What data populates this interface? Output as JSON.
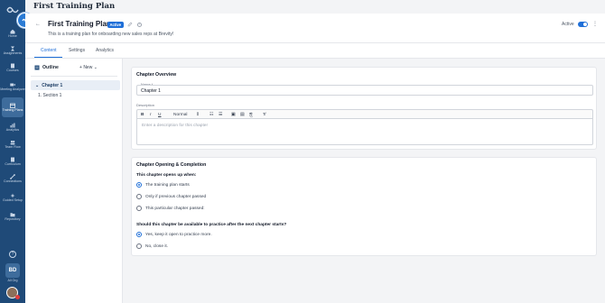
{
  "app": {
    "title": "First Training Plan"
  },
  "sidebar": {
    "items": [
      {
        "label": "Home",
        "icon": "home-icon"
      },
      {
        "label": "Assignments",
        "icon": "hourglass-icon"
      },
      {
        "label": "Courses",
        "icon": "book-icon"
      },
      {
        "label": "Meeting Analyzer",
        "icon": "video-icon"
      },
      {
        "label": "Training Plans",
        "icon": "calendar-icon"
      },
      {
        "label": "Analytics",
        "icon": "bar-chart-icon"
      },
      {
        "label": "Team Flow",
        "icon": "team-icon"
      },
      {
        "label": "Curriculum",
        "icon": "document-icon"
      },
      {
        "label": "Connections",
        "icon": "connections-icon"
      },
      {
        "label": "Guided Setup",
        "icon": "guided-setup-icon"
      },
      {
        "label": "Repository",
        "icon": "folder-icon"
      }
    ],
    "active_index": 4,
    "org_initials": "BD",
    "org_label": "All Org",
    "help_glyph": "?"
  },
  "header": {
    "back_glyph": "←",
    "title": "First Training Plan",
    "status": "Active",
    "subtitle": "This is a training plan for onboarding new sales reps at Brevity!",
    "toggle_label": "Active",
    "toggle_on": true,
    "info_glyph": "i",
    "kebab_glyph": "⋮"
  },
  "tabs": [
    "Content",
    "Settings",
    "Analytics"
  ],
  "outline": {
    "title": "Outline",
    "new_button": "New",
    "chapter": "Chapter 1",
    "section": "1. Section 1"
  },
  "overview": {
    "title": "Chapter Overview",
    "name_label": "Name *",
    "name_value": "Chapter 1",
    "description_label": "Description",
    "description_placeholder": "Enter a description for this chapter",
    "toolbar": {
      "bold": "B",
      "italic": "I",
      "underline": "U",
      "format": "Normal"
    }
  },
  "opening": {
    "title": "Chapter Opening & Completion",
    "question1": "This chapter opens up when:",
    "options1": [
      "The training plan starts",
      "Only if previous chapter passed",
      "This particular chapter passed:"
    ],
    "selected1": 0,
    "question2": "Should this chapter be available to practice after the next chapter starts?",
    "options2": [
      "Yes, keep it open to practice more.",
      "No, close it."
    ],
    "selected2": 0
  },
  "colors": {
    "sidebar": "#1f4a78",
    "accent": "#1f6fd8",
    "background": "#f3f4f6"
  }
}
